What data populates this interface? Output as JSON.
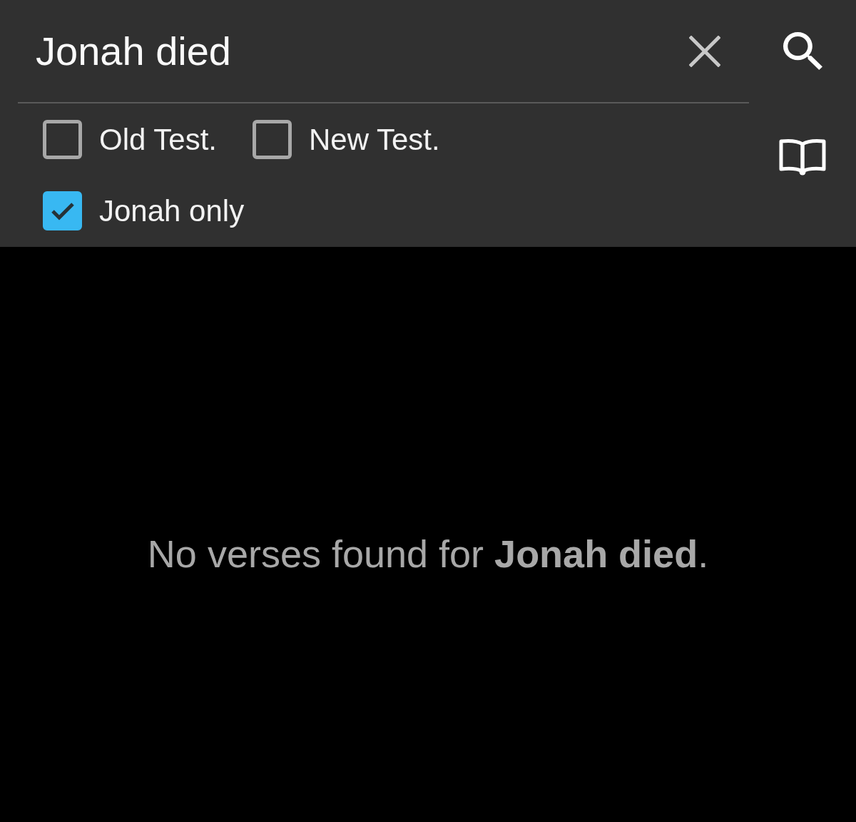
{
  "search": {
    "value": "Jonah died"
  },
  "filters": [
    {
      "label": "Old Test.",
      "checked": false
    },
    {
      "label": "New Test.",
      "checked": false
    },
    {
      "label": "Jonah only",
      "checked": true
    }
  ],
  "message": "No verses found for **Jonah died**."
}
